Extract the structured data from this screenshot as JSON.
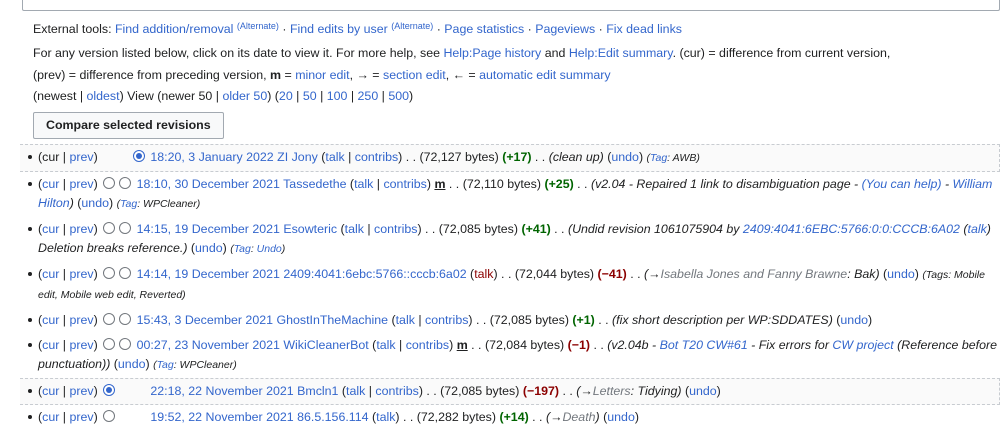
{
  "external_tools": {
    "label": "External tools:",
    "links": [
      {
        "text": "Find addition/removal",
        "alt": "(Alternate)"
      },
      {
        "text": "Find edits by user",
        "alt": "(Alternate)"
      },
      {
        "text": "Page statistics",
        "alt": ""
      },
      {
        "text": "Pageviews",
        "alt": ""
      },
      {
        "text": "Fix dead links",
        "alt": ""
      }
    ]
  },
  "help": {
    "line1_a": "For any version listed below, click on its date to view it. For more help, see ",
    "help_history": "Help:Page history",
    "and": " and ",
    "help_summary": "Help:Edit summary",
    "line1_b": ". (cur) = difference from current version,",
    "line2_a": "(prev) = difference from preceding version,  ",
    "m": "m",
    "line2_b": " = ",
    "minor_edit": "minor edit",
    "line2_c": ", → = ",
    "section_edit": "section edit",
    "line2_d": ", ← = ",
    "auto_summary": "automatic edit summary"
  },
  "nav": {
    "open": "(newest | ",
    "oldest": "oldest",
    "view": ") View (newer 50 | ",
    "older": "older 50",
    "counts_open": ") (",
    "counts": [
      "20",
      "50",
      "100",
      "250",
      "500"
    ],
    "close": ")"
  },
  "compare_button": "Compare selected revisions",
  "revisions": [
    {
      "cur": "cur",
      "prev": "prev",
      "date": "18:20, 3 January 2022",
      "user": "ZI Jony",
      "talk": "talk",
      "contribs": "contribs",
      "minor": "",
      "bytes": "(72,127 bytes)",
      "diff": "(+17)",
      "diff_sign": "pos",
      "summary": "(clean up)",
      "undo": "undo",
      "tags": "(Tag: AWB)"
    },
    {
      "cur": "cur",
      "prev": "prev",
      "date": "18:10, 30 December 2021",
      "user": "Tassedethe",
      "talk": "talk",
      "contribs": "contribs",
      "minor": "m",
      "bytes": "(72,110 bytes)",
      "diff": "(+25)",
      "diff_sign": "pos",
      "summary_pre": "(v2.04 - Repaired 1 link to disambiguation page - ",
      "summary_link": "(You can help)",
      "summary_post": " - ",
      "summary_link2": "William Hilton",
      "summary_end": ")",
      "undo": "undo",
      "tags": "(Tag: WPCleaner)"
    },
    {
      "cur": "cur",
      "prev": "prev",
      "date": "14:15, 19 December 2021",
      "user": "Esowteric",
      "talk": "talk",
      "contribs": "contribs",
      "minor": "",
      "bytes": "(72,085 bytes)",
      "diff": "(+41)",
      "diff_sign": "pos",
      "summary_pre": "(Undid revision 1061075904 by ",
      "summary_link": "2409:4041:6EBC:5766:0:0:CCCB:6A02",
      "summary_post": " (",
      "summary_link2": "talk",
      "summary_end": ") Deletion breaks reference.)",
      "undo": "undo",
      "tags": "(Tag: Undo)"
    },
    {
      "cur": "cur",
      "prev": "prev",
      "date": "14:14, 19 December 2021",
      "user": "2409:4041:6ebc:5766::cccb:6a02",
      "talk": "talk",
      "contribs": "",
      "minor": "",
      "bytes": "(72,044 bytes)",
      "diff": "(−41)",
      "diff_sign": "neg",
      "summary_arrow": "(→",
      "summary_section": "Isabella Jones and Fanny Brawne",
      "summary_rest": ": Bak)",
      "undo": "undo",
      "tags": "(Tags: Mobile edit, Mobile web edit, Reverted)"
    },
    {
      "cur": "cur",
      "prev": "prev",
      "date": "15:43, 3 December 2021",
      "user": "GhostInTheMachine",
      "talk": "talk",
      "contribs": "contribs",
      "minor": "",
      "bytes": "(72,085 bytes)",
      "diff": "(+1)",
      "diff_sign": "pos",
      "summary": "(fix short description per WP:SDDATES)",
      "undo": "undo",
      "tags": ""
    },
    {
      "cur": "cur",
      "prev": "prev",
      "date": "00:27, 23 November 2021",
      "user": "WikiCleanerBot",
      "talk": "talk",
      "contribs": "contribs",
      "minor": "m",
      "bytes": "(72,084 bytes)",
      "diff": "(−1)",
      "diff_sign": "neg",
      "summary_pre": "(v2.04b - ",
      "summary_link": "Bot T20 CW#61",
      "summary_post": " - Fix errors for ",
      "summary_link2": "CW project",
      "summary_end": " (Reference before punctuation))",
      "undo": "undo",
      "tags": "(Tag: WPCleaner)"
    },
    {
      "cur": "cur",
      "prev": "prev",
      "date": "22:18, 22 November 2021",
      "user": "Bmcln1",
      "talk": "talk",
      "contribs": "contribs",
      "minor": "",
      "bytes": "(72,085 bytes)",
      "diff": "(−197)",
      "diff_sign": "neg",
      "summary_arrow": "(→",
      "summary_section": "Letters",
      "summary_rest": ": Tidying)",
      "undo": "undo",
      "tags": ""
    },
    {
      "cur": "cur",
      "prev": "prev",
      "date": "19:52, 22 November 2021",
      "user": "86.5.156.114",
      "talk": "talk",
      "contribs": "",
      "minor": "",
      "bytes": "(72,282 bytes)",
      "diff": "(+14)",
      "diff_sign": "pos",
      "summary_arrow": "(→",
      "summary_section": "Death",
      "summary_rest": ")",
      "undo": "undo",
      "tags": ""
    }
  ]
}
